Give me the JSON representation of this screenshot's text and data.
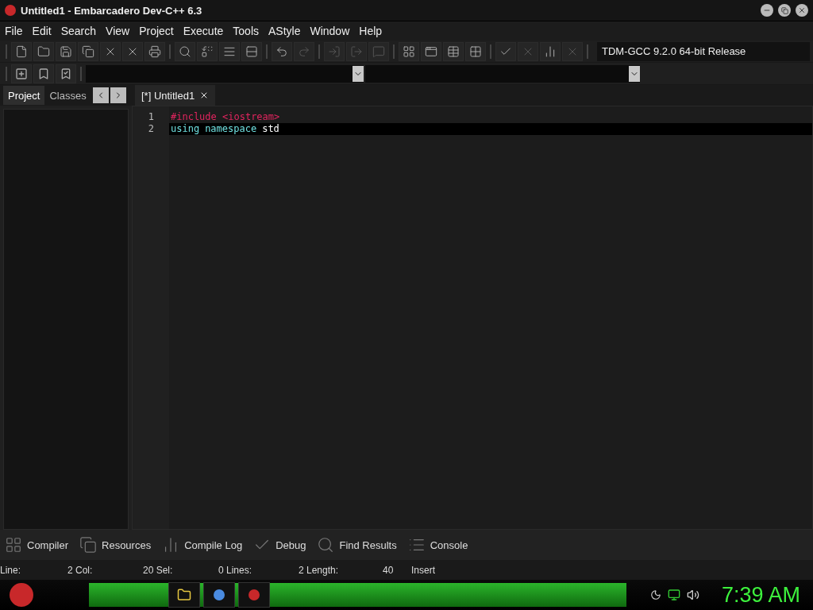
{
  "window": {
    "title": "Untitled1 - Embarcadero Dev-C++ 6.3"
  },
  "menu": [
    "File",
    "Edit",
    "Search",
    "View",
    "Project",
    "Execute",
    "Tools",
    "AStyle",
    "Window",
    "Help"
  ],
  "compiler_select": {
    "value": "TDM-GCC 9.2.0 64-bit Release"
  },
  "side_tabs": [
    {
      "label": "Project",
      "selected": true
    },
    {
      "label": "Classes",
      "selected": false
    }
  ],
  "editor_tabs": [
    {
      "label": "[*] Untitled1",
      "selected": true
    }
  ],
  "code_lines": [
    {
      "number": "1",
      "current": false,
      "tokens": [
        {
          "kind": "preprocessor",
          "text": "#include <iostream>"
        }
      ]
    },
    {
      "number": "2",
      "current": true,
      "tokens": [
        {
          "kind": "keyword",
          "text": "using"
        },
        {
          "kind": "keyword",
          "text": "namespace"
        },
        {
          "kind": "identifier",
          "text": "std"
        }
      ]
    }
  ],
  "bottom_tabs": [
    {
      "label": "Compiler",
      "kind": "grid"
    },
    {
      "label": "Resources",
      "kind": "copies"
    },
    {
      "label": "Compile Log",
      "kind": "chart"
    },
    {
      "label": "Debug",
      "kind": "check"
    },
    {
      "label": "Find Results",
      "kind": "search"
    },
    {
      "label": "Console",
      "kind": "list"
    }
  ],
  "status_bar": [
    "Line:",
    "2 Col:",
    "20 Sel:",
    "0 Lines:",
    "2 Length:",
    "40",
    "Insert"
  ],
  "taskbar": {
    "clock": "7:39 AM"
  }
}
